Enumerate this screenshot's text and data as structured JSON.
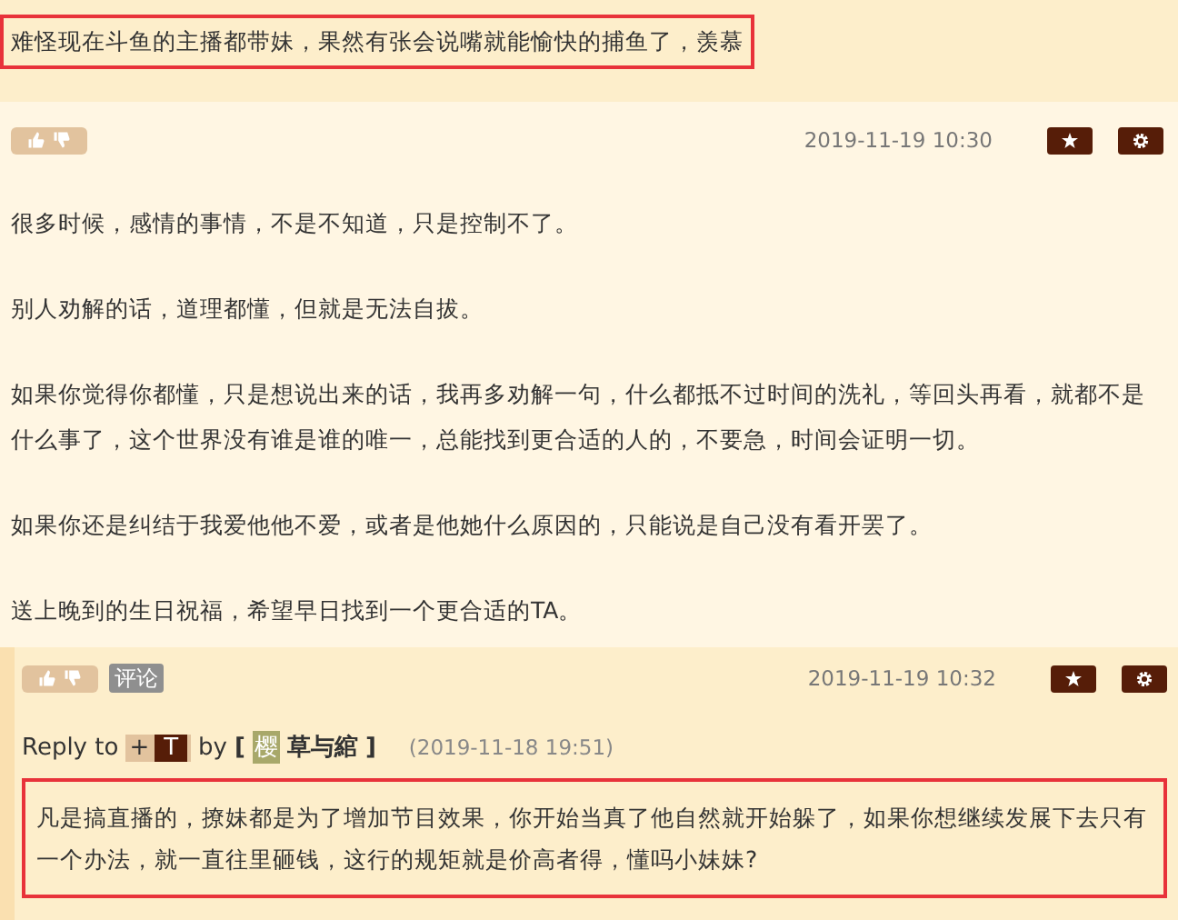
{
  "top_comment": {
    "text": "难怪现在斗鱼的主播都带妹，果然有张会说嘴就能愉快的捕鱼了，羡慕",
    "highlighted": true
  },
  "post": {
    "date": "2019-11-19 10:30",
    "paragraphs": [
      "很多时候，感情的事情，不是不知道，只是控制不了。",
      "别人劝解的话，道理都懂，但就是无法自拔。",
      "如果你觉得你都懂，只是想说出来的话，我再多劝解一句，什么都抵不过时间的洗礼，等回头再看，就都不是什么事了，这个世界没有谁是谁的唯一，总能找到更合适的人的，不要急，时间会证明一切。",
      "如果你还是纠结于我爱他他不爱，或者是他她什么原因的，只能说是自己没有看开罢了。",
      "送上晚到的生日祝福，希望早日找到一个更合适的TA。"
    ]
  },
  "reply": {
    "tag": "评论",
    "date": "2019-11-19 10:32",
    "reply_to": {
      "prefix": "Reply to",
      "plus": "+",
      "user_initial": "T",
      "by": "by",
      "open": "[",
      "avatar": "樱",
      "name": "草与綰",
      "close": "]",
      "date": "(2019-11-18 19:51)"
    },
    "text": "凡是搞直播的，撩妹都是为了增加节目效果，你开始当真了他自然就开始躲了，如果你想继续发展下去只有一个办法，就一直往里砸钱，这行的规矩就是价高者得，懂吗小妹妹?",
    "highlighted": true
  }
}
